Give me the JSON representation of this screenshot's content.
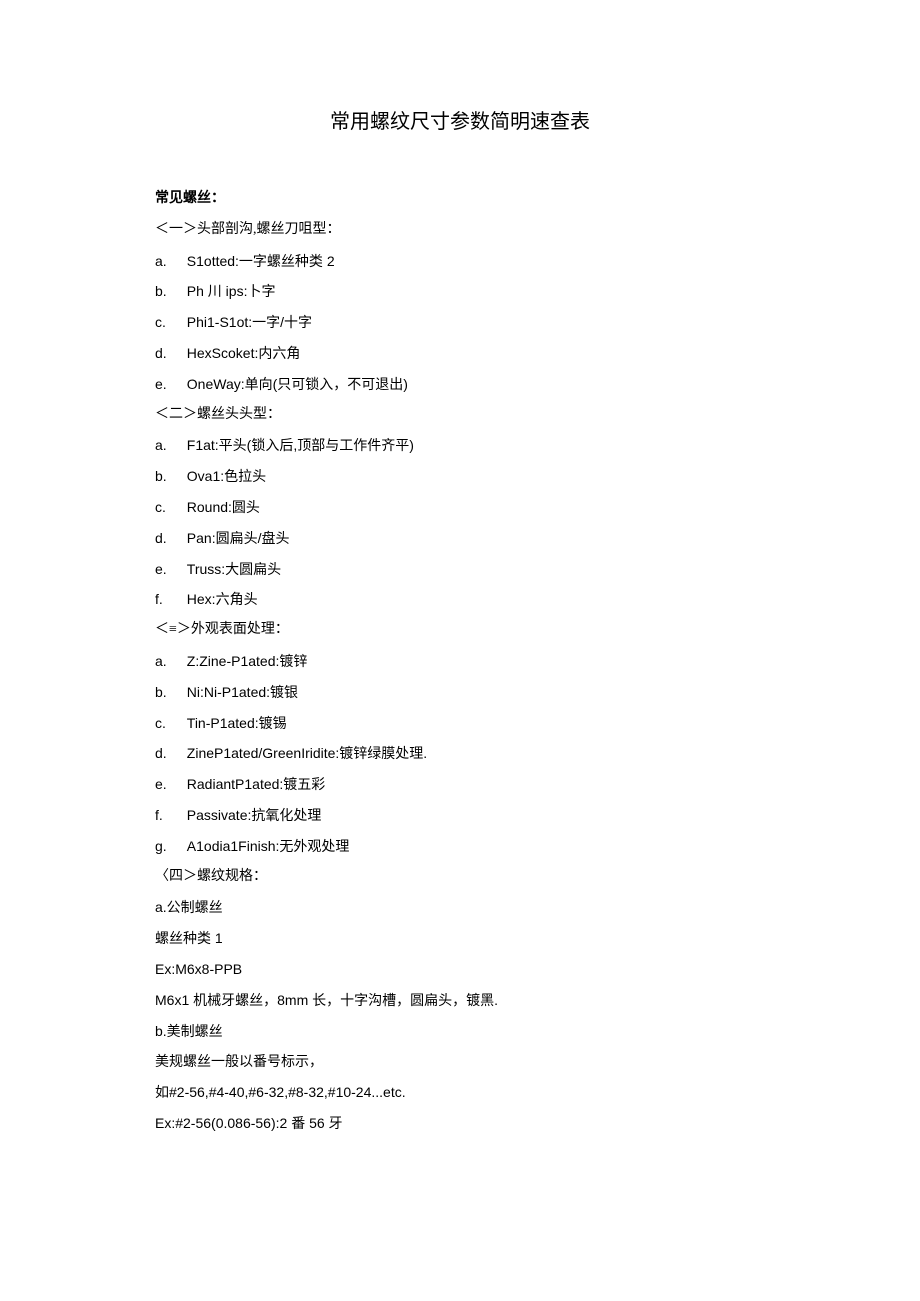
{
  "title": "常用螺纹尺寸参数简明速查表",
  "header1": "常见螺丝：",
  "section1": {
    "title": "＜一＞头部剖沟,螺丝刀咀型：",
    "items": [
      {
        "label": "a.",
        "text": "S1otted:一字螺丝种类 2"
      },
      {
        "label": "b.",
        "text": "Ph 川 ips:卜字"
      },
      {
        "label": "c.",
        "text": "Phi1-S1ot:一字/十字"
      },
      {
        "label": "d.",
        "text": "HexScoket:内六角"
      },
      {
        "label": "e.",
        "text": "OneWay:单向(只可锁入，不可退出)"
      }
    ]
  },
  "section2": {
    "title": "＜二＞螺丝头头型：",
    "items": [
      {
        "label": "a.",
        "text": "F1at:平头(锁入后,顶部与工作件齐平)"
      },
      {
        "label": "b.",
        "text": "Ova1:色拉头"
      },
      {
        "label": "c.",
        "text": "Round:圆头"
      },
      {
        "label": "d.",
        "text": "Pan:圆扁头/盘头"
      },
      {
        "label": "e.",
        "text": "Truss:大圆扁头"
      },
      {
        "label": "f.",
        "text": "Hex:六角头"
      }
    ]
  },
  "section3": {
    "title": "＜≡＞外观表面处理：",
    "items": [
      {
        "label": "a.",
        "text": "Z:Zine-P1ated:镀锌"
      },
      {
        "label": "b.",
        "text": "Ni:Ni-P1ated:镀银"
      },
      {
        "label": "c.",
        "text": "Tin-P1ated:镀锡"
      },
      {
        "label": "d.",
        "text": "ZineP1ated/GreenIridite:镀锌绿膜处理."
      },
      {
        "label": "e.",
        "text": "RadiantP1ated:镀五彩"
      },
      {
        "label": "f.",
        "text": "Passivate:抗氧化处理"
      },
      {
        "label": "g.",
        "text": "A1odia1Finish:无外观处理"
      }
    ]
  },
  "section4": {
    "title": "〈四＞螺纹规格：",
    "lines": [
      "a.公制螺丝",
      "螺丝种类 1",
      "Ex:M6x8-PPB",
      "M6x1 机械牙螺丝，8mm 长，十字沟槽，圆扁头，镀黑.",
      "b.美制螺丝",
      "美规螺丝一般以番号标示，",
      "如#2-56,#4-40,#6-32,#8-32,#10-24...etc.",
      "Ex:#2-56(0.086-56):2 番 56 牙"
    ]
  }
}
